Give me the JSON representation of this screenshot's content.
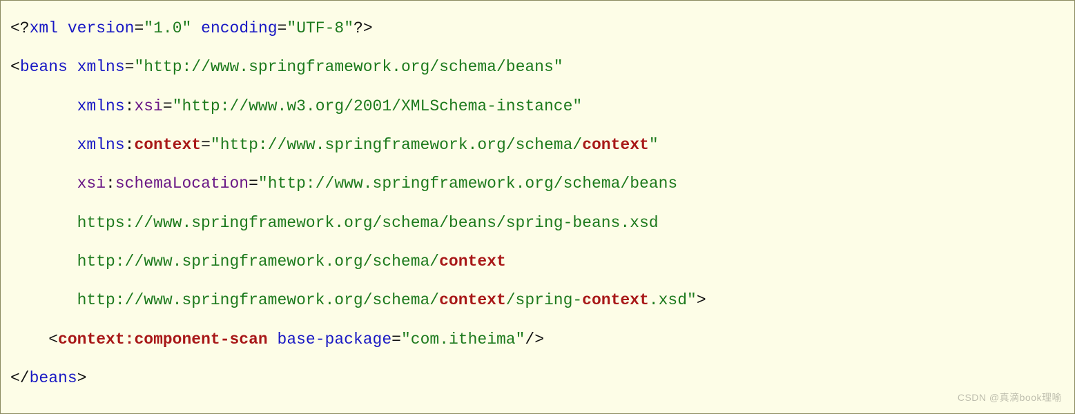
{
  "code": {
    "line1": {
      "open": "<?",
      "xml": "xml",
      "version_attr": "version",
      "eq": "=",
      "q": "\"",
      "version_val": "1.0",
      "encoding_attr": "encoding",
      "encoding_val": "UTF-8",
      "close": "?>"
    },
    "beans_open": {
      "lt": "<",
      "tag": "beans",
      "xmlns_attr": "xmlns",
      "xmlns_val": "http://www.springframework.org/schema/beans",
      "xmlns_prefix": "xmlns",
      "colon": ":",
      "xsi": "xsi",
      "xsi_val": "http://www.w3.org/2001/XMLSchema-instance",
      "context_attr": "context",
      "context_val_pre": "http://www.springframework.org/schema/",
      "context_word": "context",
      "schemaLocation": "schemaLocation",
      "sl_val1": "http://www.springframework.org/schema/beans",
      "sl_val2": "https://www.springframework.org/schema/beans/spring-beans.xsd",
      "sl_val3_pre": "http://www.springframework.org/schema/",
      "sl_val4_pre": "http://www.springframework.org/schema/",
      "sl_val4_mid": "/spring-",
      "sl_val4_suf": ".xsd",
      "gt": ">"
    },
    "scan": {
      "lt": "<",
      "prefix": "context",
      "colon": ":",
      "name": "component-scan",
      "attr": "base-package",
      "val": "com.itheima",
      "selfclose": "/>"
    },
    "beans_close": {
      "lt": "</",
      "tag": "beans",
      "gt": ">"
    }
  },
  "watermark": "CSDN @真滴book理喻"
}
